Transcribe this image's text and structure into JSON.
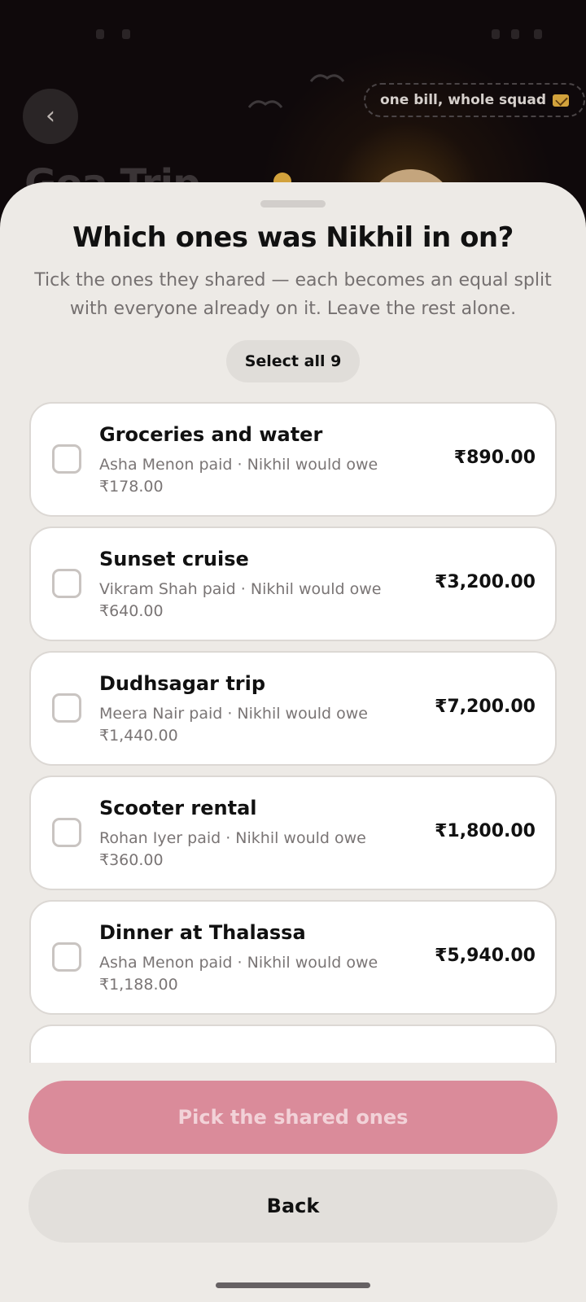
{
  "background": {
    "back_glyph": "‹",
    "tagline": "one bill, whole squad",
    "tagline_icon": "mail-icon",
    "title": "Goa Trip"
  },
  "sheet": {
    "title": "Which ones was Nikhil in on?",
    "subtitle": "Tick the ones they shared — each becomes an equal split with everyone already on it. Leave the rest alone.",
    "select_all_label": "Select all 9",
    "expenses": [
      {
        "title": "Groceries and water",
        "meta": "Asha Menon paid · Nikhil would owe ₹178.00",
        "amount": "₹890.00",
        "checked": false
      },
      {
        "title": "Sunset cruise",
        "meta": "Vikram Shah paid · Nikhil would owe ₹640.00",
        "amount": "₹3,200.00",
        "checked": false
      },
      {
        "title": "Dudhsagar trip",
        "meta": "Meera Nair paid · Nikhil would owe ₹1,440.00",
        "amount": "₹7,200.00",
        "checked": false
      },
      {
        "title": "Scooter rental",
        "meta": "Rohan Iyer paid · Nikhil would owe ₹360.00",
        "amount": "₹1,800.00",
        "checked": false
      },
      {
        "title": "Dinner at Thalassa",
        "meta": "Asha Menon paid · Nikhil would owe ₹1,188.00",
        "amount": "₹5,940.00",
        "checked": false
      },
      {
        "title": "",
        "meta": "",
        "amount": "",
        "checked": false
      }
    ],
    "primary_button": "Pick the shared ones",
    "secondary_button": "Back"
  },
  "colors": {
    "primary_button_bg": "#da8b9a",
    "sheet_bg": "#edeae6",
    "header_bg": "#0f090b"
  }
}
